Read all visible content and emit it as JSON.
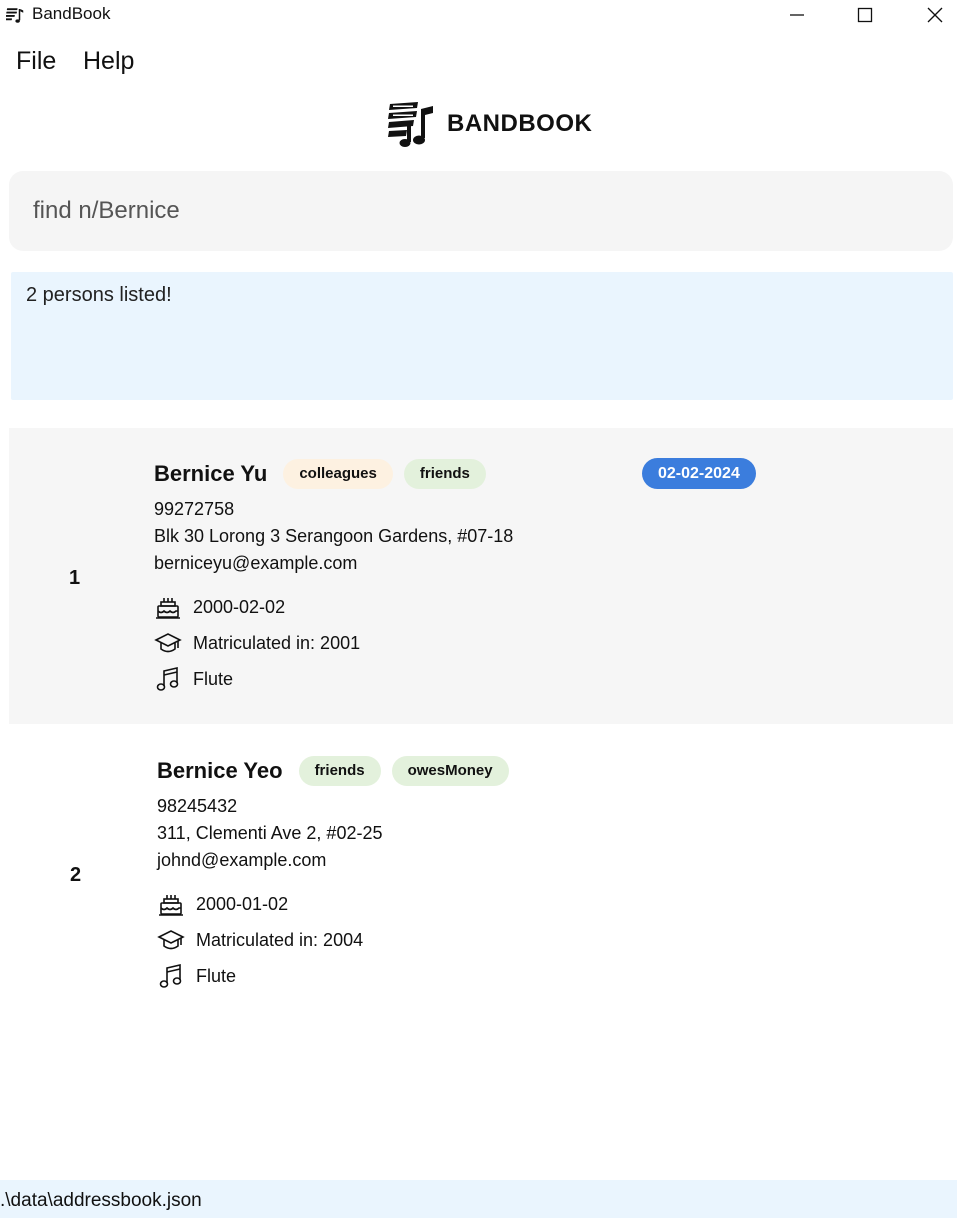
{
  "window": {
    "title": "BandBook",
    "minimize_icon": "minimize-icon",
    "maximize_icon": "maximize-icon",
    "close_icon": "close-icon"
  },
  "menu": {
    "file": "File",
    "help": "Help"
  },
  "brand": {
    "logo_icon": "music-score-icon",
    "name": "BANDBOOK"
  },
  "command": {
    "value": "find n/Bernice"
  },
  "result": {
    "message": "2 persons listed!"
  },
  "persons": [
    {
      "index": "1",
      "name": "Bernice Yu",
      "tags": [
        "colleagues",
        "friends"
      ],
      "attendance_date": "02-02-2024",
      "phone": "99272758",
      "address": "Blk 30 Lorong 3 Serangoon Gardens, #07-18",
      "email": "berniceyu@example.com",
      "birthday": "2000-02-02",
      "matriculation": "Matriculated in: 2001",
      "instrument": "Flute"
    },
    {
      "index": "2",
      "name": "Bernice Yeo",
      "tags": [
        "friends",
        "owesMoney"
      ],
      "phone": "98245432",
      "address": "311, Clementi Ave 2, #02-25",
      "email": "johnd@example.com",
      "birthday": "2000-01-02",
      "matriculation": "Matriculated in: 2004",
      "instrument": "Flute"
    }
  ],
  "icons": {
    "birthday": "cake-icon",
    "matriculation": "graduation-cap-icon",
    "instrument": "music-note-icon"
  },
  "colors": {
    "tag_colleagues": "#fdf1e1",
    "tag_friends": "#e3f1dc",
    "date_badge": "#3b7ddd",
    "result_bg": "#eaf5fe",
    "card_alt_bg": "#f6f6f6"
  },
  "status": {
    "path": ".\\data\\addressbook.json"
  }
}
